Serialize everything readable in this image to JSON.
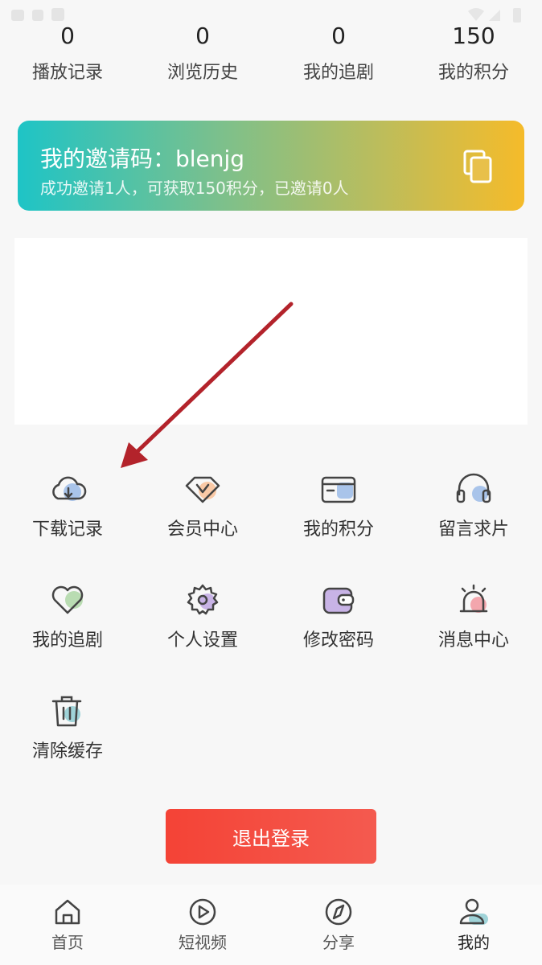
{
  "stats": [
    {
      "value": "0",
      "label": "播放记录"
    },
    {
      "value": "0",
      "label": "浏览历史"
    },
    {
      "value": "0",
      "label": "我的追剧"
    },
    {
      "value": "150",
      "label": "我的积分"
    }
  ],
  "invite": {
    "title": "我的邀请码：blenjg",
    "subtitle": "成功邀请1人，可获取150积分，已邀请0人",
    "icon": "copy-icon"
  },
  "menu": [
    {
      "label": "下载记录",
      "icon": "cloud-download-icon"
    },
    {
      "label": "会员中心",
      "icon": "vip-diamond-icon"
    },
    {
      "label": "我的积分",
      "icon": "card-icon"
    },
    {
      "label": "留言求片",
      "icon": "headphones-icon"
    },
    {
      "label": "我的追剧",
      "icon": "heart-icon"
    },
    {
      "label": "个人设置",
      "icon": "gear-icon"
    },
    {
      "label": "修改密码",
      "icon": "wallet-icon"
    },
    {
      "label": "消息中心",
      "icon": "alarm-bell-icon"
    },
    {
      "label": "清除缓存",
      "icon": "trash-icon"
    }
  ],
  "logout_label": "退出登录",
  "tabs": [
    {
      "label": "首页",
      "icon": "home-icon"
    },
    {
      "label": "短视频",
      "icon": "play-circle-icon"
    },
    {
      "label": "分享",
      "icon": "compass-icon"
    },
    {
      "label": "我的",
      "icon": "user-icon",
      "active": true
    }
  ],
  "colors": {
    "accent_red": "#f44336",
    "invite_gradient_start": "#1ec4c6",
    "invite_gradient_end": "#f5bb2a",
    "annotation_arrow": "#b3232b"
  }
}
